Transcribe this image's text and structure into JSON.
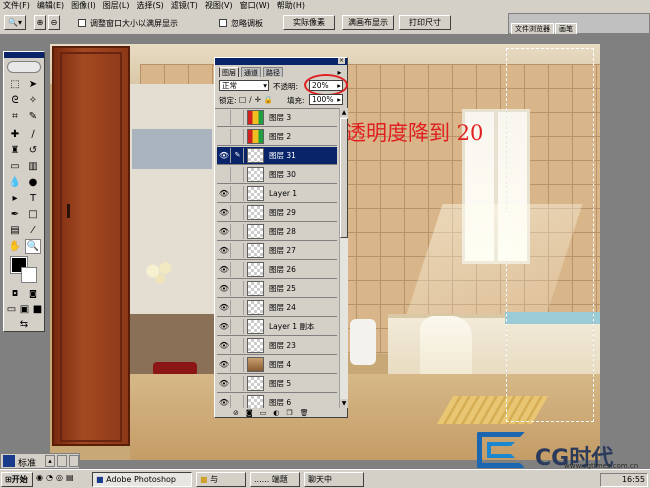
{
  "menu": [
    "文件(F)",
    "编辑(E)",
    "图像(I)",
    "图层(L)",
    "选择(S)",
    "滤镜(T)",
    "视图(V)",
    "窗口(W)",
    "帮助(H)"
  ],
  "options": {
    "resize_windows_label": "调整窗口大小以满屏显示",
    "ignore_palettes_label": "忽略调板",
    "actual_pixels_button": "实际像素",
    "fit_screen_button": "满画布显示",
    "print_size_button": "打印尺寸"
  },
  "palette_well": {
    "tabs": [
      "文件浏览器",
      "画笔"
    ]
  },
  "layers_palette": {
    "tabs": [
      "图层",
      "通道",
      "路径"
    ],
    "blend_mode": "正常",
    "opacity_label": "不透明:",
    "opacity_value": "20%",
    "lock_label": "锁定:",
    "fill_label": "填充:",
    "fill_value": "100%",
    "layers": [
      {
        "name": "图层 3",
        "visible": false,
        "thumb": "color",
        "selected": false
      },
      {
        "name": "图层 2",
        "visible": false,
        "thumb": "color",
        "selected": false
      },
      {
        "name": "图层 31",
        "visible": true,
        "thumb": "transparent",
        "selected": true
      },
      {
        "name": "图层 30",
        "visible": false,
        "thumb": "transparent",
        "selected": false
      },
      {
        "name": "Layer 1",
        "visible": true,
        "thumb": "transparent",
        "selected": false
      },
      {
        "name": "图层 29",
        "visible": true,
        "thumb": "transparent",
        "selected": false
      },
      {
        "name": "图层 28",
        "visible": true,
        "thumb": "transparent",
        "selected": false
      },
      {
        "name": "图层 27",
        "visible": true,
        "thumb": "transparent",
        "selected": false
      },
      {
        "name": "图层 26",
        "visible": true,
        "thumb": "transparent",
        "selected": false
      },
      {
        "name": "图层 25",
        "visible": true,
        "thumb": "transparent",
        "selected": false
      },
      {
        "name": "图层 24",
        "visible": true,
        "thumb": "transparent",
        "selected": false
      },
      {
        "name": "Layer 1 副本",
        "visible": true,
        "thumb": "transparent",
        "selected": false
      },
      {
        "name": "图层 23",
        "visible": true,
        "thumb": "transparent",
        "selected": false
      },
      {
        "name": "图层 4",
        "visible": true,
        "thumb": "image",
        "selected": false
      },
      {
        "name": "图层 5",
        "visible": true,
        "thumb": "transparent",
        "selected": false
      },
      {
        "name": "图层 6",
        "visible": true,
        "thumb": "transparent",
        "selected": false
      }
    ]
  },
  "annotation": "透明度降到 20",
  "statusbar": {
    "zoom": "标准"
  },
  "taskbar": {
    "start_label": "开始",
    "tasks": [
      "Adobe Photoshop",
      "与",
      "...... 端题",
      "聊天中"
    ],
    "clock": "16:55"
  },
  "watermark": {
    "brand": "CG时代",
    "url": "www.cgtimes.com.cn"
  },
  "colors": {
    "title_blue": "#0a246a",
    "annotation_red": "#e02020",
    "ui_gray": "#d4d0c8"
  }
}
